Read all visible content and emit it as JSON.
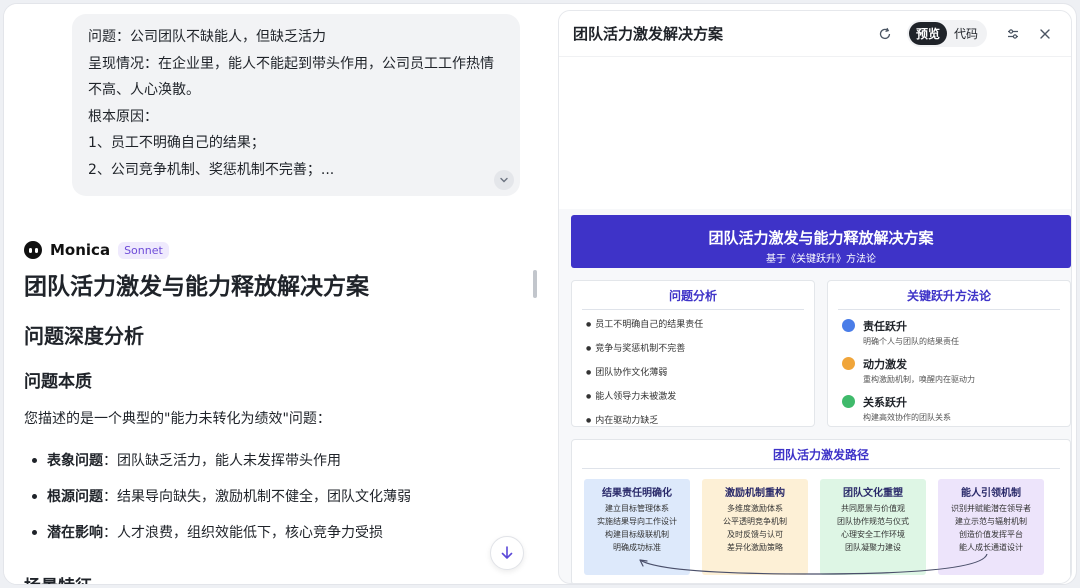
{
  "chat": {
    "user_message": {
      "lines": [
        "问题：公司团队不缺能人，但缺乏活力",
        "呈现情况：在企业里，能人不能起到带头作用，公司员工工作热情不高、人心涣散。",
        "根本原因：",
        "1、员工不明确自己的结果；",
        "2、公司竞争机制、奖惩机制不完善；..."
      ],
      "expand_icon": "chevron-down-icon"
    },
    "bot": {
      "name": "Monica",
      "model": "Sonnet"
    },
    "answer": {
      "title": "团队活力激发与能力释放解决方案",
      "section": "问题深度分析",
      "subsection": "问题本质",
      "intro": "您描述的是一个典型的\"能力未转化为绩效\"问题：",
      "bullets": [
        {
          "label": "表象问题",
          "text": "：团队缺乏活力，能人未发挥带头作用"
        },
        {
          "label": "根源问题",
          "text": "：结果导向缺失，激励机制不健全，团队文化薄弱"
        },
        {
          "label": "潜在影响",
          "text": "：人才浪费，组织效能低下，核心竞争力受损"
        }
      ],
      "next_heading": "场景特征"
    }
  },
  "panel": {
    "title": "团队活力激发解决方案",
    "toggle": {
      "preview": "预览",
      "code": "代码",
      "selected": "预览"
    },
    "icons": {
      "refresh": "refresh-icon",
      "settings": "sliders-icon",
      "close": "close-icon"
    },
    "banner": {
      "title": "团队活力激发与能力释放解决方案",
      "subtitle": "基于《关键跃升》方法论"
    },
    "problems": {
      "title": "问题分析",
      "items": [
        "员工不明确自己的结果责任",
        "竞争与奖惩机制不完善",
        "团队协作文化薄弱",
        "能人领导力未被激发",
        "内在驱动力缺乏"
      ]
    },
    "methods": {
      "title": "关键跃升方法论",
      "items": [
        {
          "name": "责任跃升",
          "desc": "明确个人与团队的结果责任",
          "color": "#4a7de8"
        },
        {
          "name": "动力激发",
          "desc": "重构激励机制，唤醒内在驱动力",
          "color": "#f0a53a"
        },
        {
          "name": "关系跃升",
          "desc": "构建高效协作的团队关系",
          "color": "#3fba6b"
        }
      ]
    },
    "path": {
      "title": "团队活力激发路径",
      "steps": [
        {
          "name": "结果责任明确化",
          "lines": [
            "建立目标管理体系",
            "实施结果导向工作设计",
            "构建目标级联机制",
            "明确成功标准"
          ],
          "color": "#dde9fb"
        },
        {
          "name": "激励机制重构",
          "lines": [
            "多维度激励体系",
            "公平透明竞争机制",
            "及时反馈与认可",
            "差异化激励策略"
          ],
          "color": "#fdf0d6"
        },
        {
          "name": "团队文化重塑",
          "lines": [
            "共同愿景与价值观",
            "团队协作规范与仪式",
            "心理安全工作环境",
            "团队凝聚力建设"
          ],
          "color": "#def6e5"
        },
        {
          "name": "能人引领机制",
          "lines": [
            "识别并赋能潜在领导者",
            "建立示范与辐射机制",
            "创造价值发挥平台",
            "能人成长通道设计"
          ],
          "color": "#ede4fb"
        }
      ]
    }
  },
  "scroll": {
    "icon": "arrow-down-icon"
  }
}
